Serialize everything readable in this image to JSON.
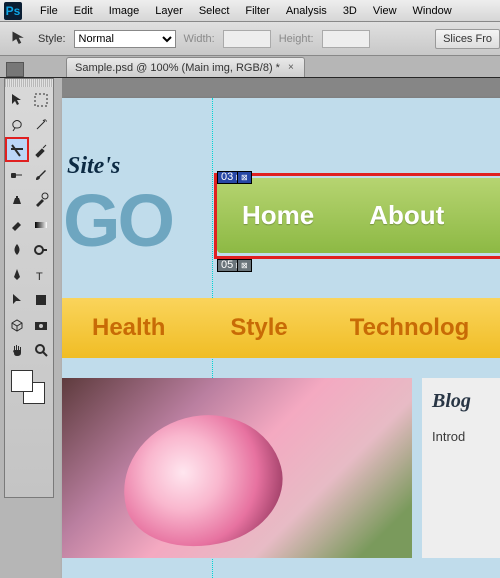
{
  "menubar": {
    "items": [
      "File",
      "Edit",
      "Image",
      "Layer",
      "Select",
      "Filter",
      "Analysis",
      "3D",
      "View",
      "Window"
    ]
  },
  "options": {
    "style_label": "Style:",
    "style_value": "Normal",
    "width_label": "Width:",
    "height_label": "Height:",
    "slices_btn": "Slices Fro"
  },
  "tab": {
    "title": "Sample.psd @ 100% (Main img, RGB/8) *"
  },
  "logo": {
    "top": "Site's",
    "big": "GO"
  },
  "nav": {
    "home": "Home",
    "about": "About"
  },
  "slices": {
    "a": "03",
    "b": "05"
  },
  "cats": {
    "a": "Health",
    "b": "Style",
    "c": "Technolog"
  },
  "side": {
    "h": "Blog",
    "p": "Introd"
  }
}
